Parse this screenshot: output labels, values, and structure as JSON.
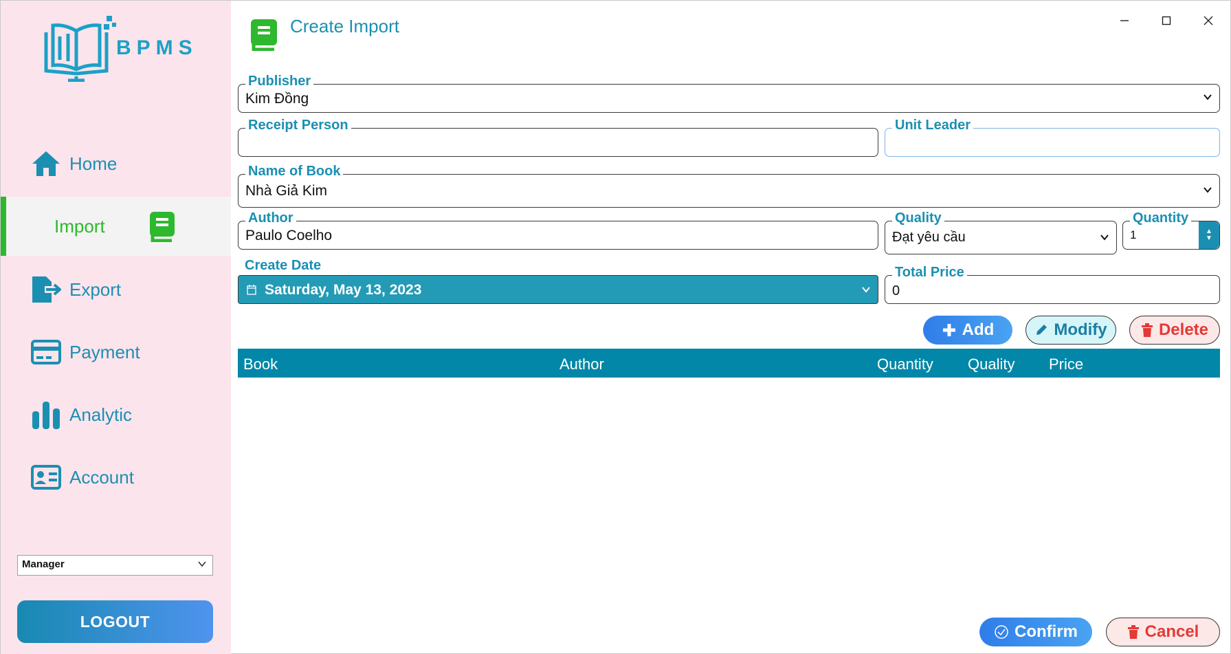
{
  "app": {
    "logo_text": "BPMS"
  },
  "sidebar": {
    "items": [
      {
        "label": "Home",
        "icon": "home-icon"
      },
      {
        "label": "Import",
        "icon": "book-icon",
        "active": true
      },
      {
        "label": "Export",
        "icon": "export-icon"
      },
      {
        "label": "Payment",
        "icon": "card-icon"
      },
      {
        "label": "Analytic",
        "icon": "bar-chart-icon"
      },
      {
        "label": "Account",
        "icon": "id-card-icon"
      }
    ],
    "role": "Manager",
    "logout_label": "LOGOUT"
  },
  "header": {
    "title": "Create Import"
  },
  "form": {
    "publisher": {
      "label": "Publisher",
      "value": "Kim Đồng"
    },
    "receipt_person": {
      "label": "Receipt Person",
      "value": ""
    },
    "unit_leader": {
      "label": "Unit Leader",
      "value": ""
    },
    "book_name": {
      "label": "Name of Book",
      "value": "Nhà Giả Kim"
    },
    "author": {
      "label": "Author",
      "value": "Paulo Coelho"
    },
    "quality": {
      "label": "Quality",
      "value": "Đạt yêu cầu"
    },
    "quantity": {
      "label": "Quantity",
      "value": "1"
    },
    "create_date": {
      "label": "Create Date",
      "value": "Saturday, May 13, 2023"
    },
    "total_price": {
      "label": "Total Price",
      "value": "0"
    }
  },
  "actions": {
    "add": "Add",
    "modify": "Modify",
    "delete": "Delete"
  },
  "table": {
    "columns": [
      "Book",
      "Author",
      "Quantity",
      "Quality",
      "Price"
    ]
  },
  "footer": {
    "confirm": "Confirm",
    "cancel": "Cancel"
  },
  "colors": {
    "accent": "#1b8fb2",
    "active": "#2eb82e",
    "sidebar_bg": "#fce4ec",
    "danger": "#e53935"
  }
}
